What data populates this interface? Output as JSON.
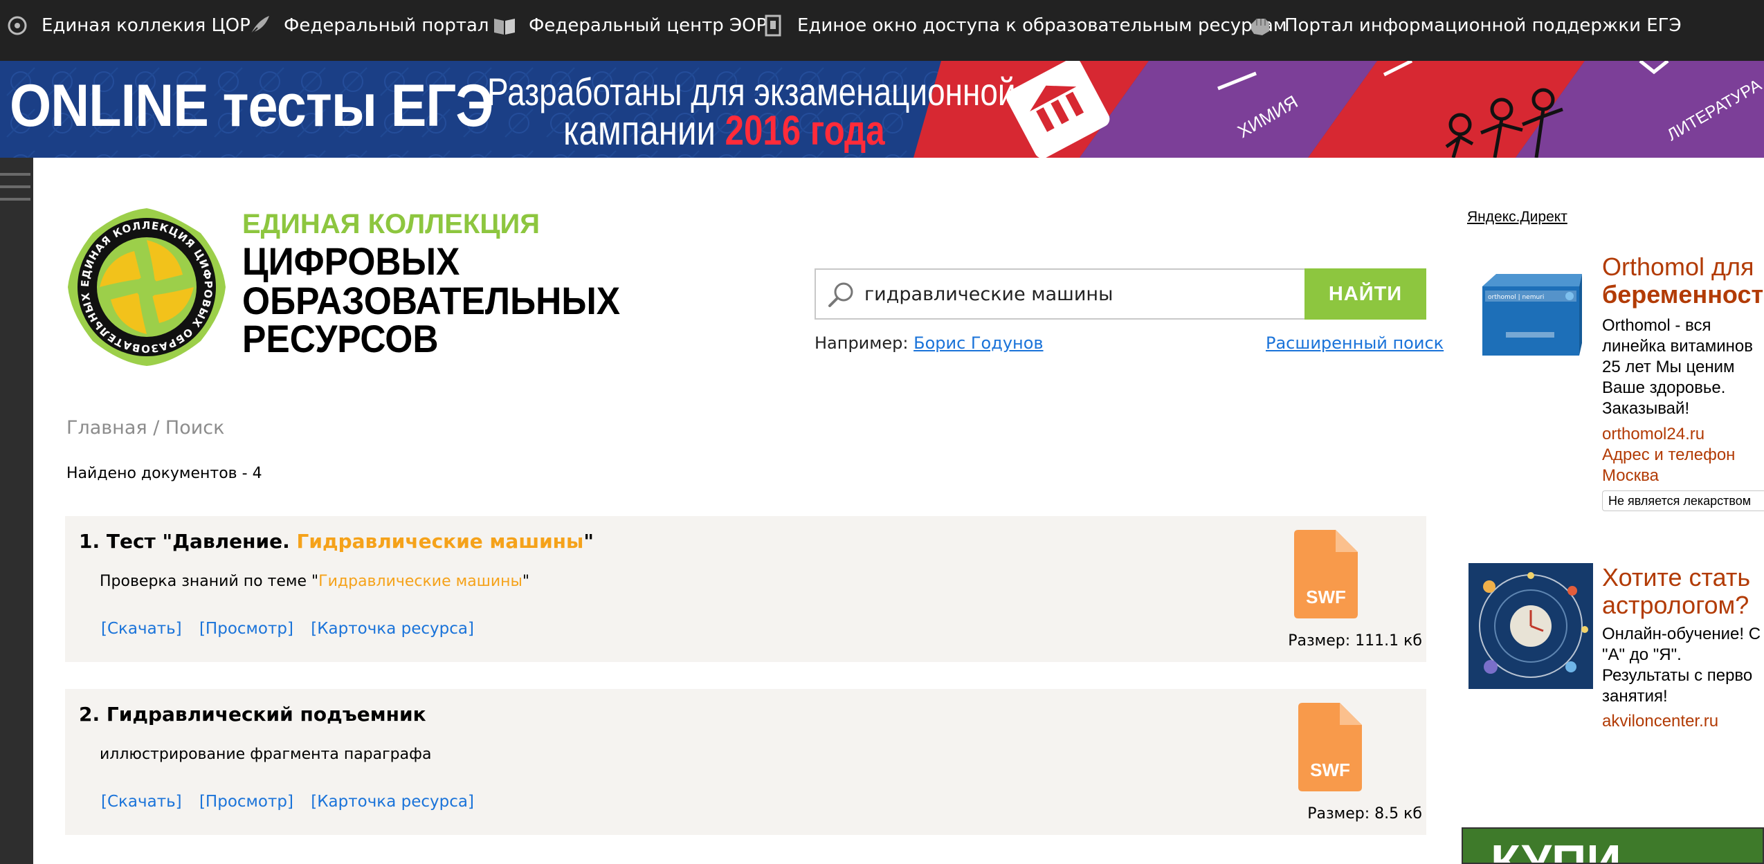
{
  "topnav": {
    "items": [
      {
        "label": "Единая коллекия ЦОР",
        "icon": "disc-icon"
      },
      {
        "label": "Федеральный портал",
        "icon": "quill-icon"
      },
      {
        "label": "Федеральный центр ЭОР",
        "icon": "book-icon"
      },
      {
        "label": "Единое окно доступа к образовательным ресурсам",
        "icon": "window-icon"
      },
      {
        "label": "Портал информационной поддержки ЕГЭ",
        "icon": "hand-icon"
      }
    ]
  },
  "banner": {
    "title": "ONLINE тесты ЕГЭ",
    "line1": "Разработаны для экзаменационной",
    "line2_prefix": "кампании ",
    "line2_year": "2016 года",
    "tag1": "ХИМИЯ",
    "tag2": "ЛИТЕРАТУРА"
  },
  "logo": {
    "ring_text": "ЕДИНАЯ КОЛЛЕКЦИЯ ЦИФРОВЫХ ОБРАЗОВАТЕЛЬНЫХ РЕСУРСОВ",
    "line1": "ЕДИНАЯ КОЛЛЕКЦИЯ",
    "line2": "ЦИФРОВЫХ",
    "line3": "ОБРАЗОВАТЕЛЬНЫХ",
    "line4": "РЕСУРСОВ"
  },
  "search": {
    "value": "гидравлические машины",
    "button_label": "НАЙТИ",
    "example_prefix": "Например: ",
    "example_link": "Борис Годунов",
    "advanced_link": "Расширенный поиск"
  },
  "breadcrumb": {
    "home": "Главная",
    "separator": " / ",
    "current": "Поиск"
  },
  "found_text": "Найдено документов - 4",
  "results": [
    {
      "title_prefix": "1. Тест \"Давление. ",
      "title_highlight": "Гидравлические машины",
      "title_suffix": "\"",
      "desc_prefix": "Проверка знаний по теме \"",
      "desc_highlight": "Гидравлические машины",
      "desc_suffix": "\"",
      "links": [
        "[Скачать]",
        "[Просмотр]",
        "[Карточка ресурса]"
      ],
      "file_type": "SWF",
      "size": "Размер: 111.1 кб"
    },
    {
      "title_prefix": "2. Гидравлический подъемник",
      "title_highlight": "",
      "title_suffix": "",
      "desc_prefix": "иллюстрирование фрагмента параграфа",
      "desc_highlight": "",
      "desc_suffix": "",
      "links": [
        "[Скачать]",
        "[Просмотр]",
        "[Карточка ресурса]"
      ],
      "file_type": "SWF",
      "size": "Размер: 8.5 кб"
    }
  ],
  "ads": {
    "label": "Яндекс.Директ",
    "ad1": {
      "title_l1": "Orthomol для",
      "title_l2": "беременност",
      "body": [
        "Orthomol - вся",
        "линейка витаминов",
        "25 лет Мы ценим",
        "Ваше здоровье.",
        "Заказывай!"
      ],
      "domain": "orthomol24.ru",
      "extra": [
        "Адрес и телефон",
        "Москва"
      ],
      "disclaimer": "Не является лекарством",
      "product_label": "orthomol | nemuri"
    },
    "ad2": {
      "title_l1": "Хотите стать",
      "title_l2": "астрологом?",
      "body": [
        "Онлайн-обучение! С",
        "\"А\" до \"Я\".",
        "Результаты с перво",
        "занятия!"
      ],
      "domain": "akviloncenter.ru"
    },
    "ad3": {
      "text": "КУПИ"
    }
  },
  "colors": {
    "accent_green": "#8dc63f",
    "highlight_orange": "#f5a21a",
    "link_blue": "#1a73d9",
    "ad_title": "#b23b05",
    "swf_orange": "#f89a4b",
    "nav_bg": "#222222",
    "banner_bg": "#1b3f86"
  }
}
